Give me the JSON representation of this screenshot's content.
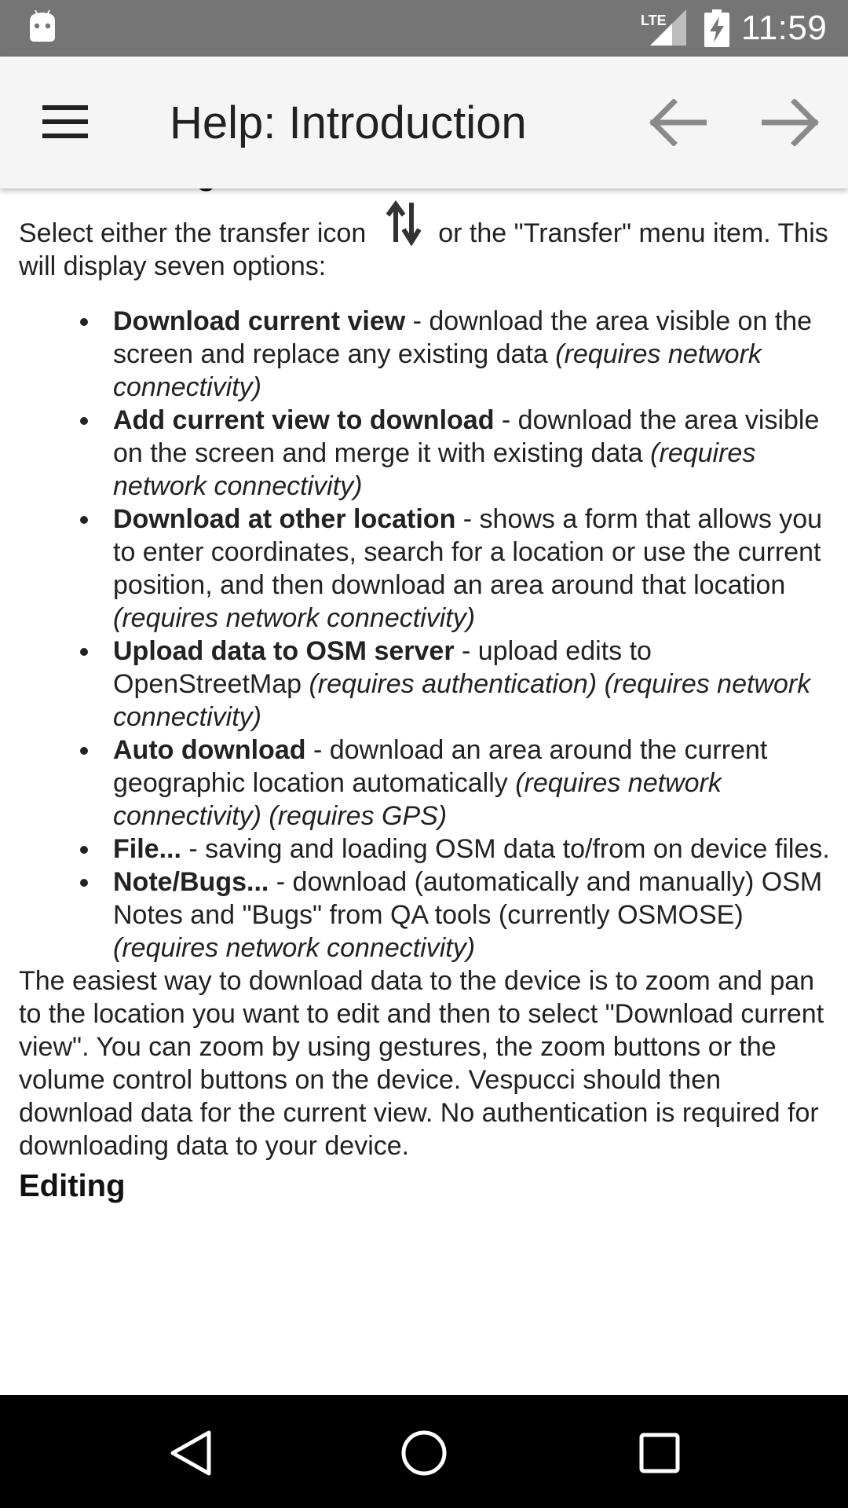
{
  "status_bar": {
    "network": "LTE",
    "time": "11:59"
  },
  "app_bar": {
    "title": "Help: Introduction"
  },
  "content": {
    "section_title": "Downloading OSM Data",
    "intro_before_icon": "Select either the transfer icon",
    "intro_after_icon": "or the \"Transfer\" menu item. This will display seven options:",
    "options": [
      {
        "name": "Download current view",
        "desc": " - download the area visible on the screen and replace any existing data ",
        "note": "(requires network connectivity)"
      },
      {
        "name": "Add current view to download",
        "desc": " - download the area visible on the screen and merge it with existing data ",
        "note": "(requires network connectivity)"
      },
      {
        "name": "Download at other location",
        "desc": " - shows a form that allows you to enter coordinates, search for a location or use the current position, and then download an area around that location ",
        "note": "(requires network connectivity)"
      },
      {
        "name": "Upload data to OSM server",
        "desc": " - upload edits to OpenStreetMap ",
        "note": "(requires authentication) (requires network connectivity)"
      },
      {
        "name": "Auto download",
        "desc": " - download an area around the current geographic location automatically ",
        "note": "(requires network connectivity) (requires GPS)"
      },
      {
        "name": "File...",
        "desc": " - saving and loading OSM data to/from on device files.",
        "note": ""
      },
      {
        "name": "Note/Bugs...",
        "desc": " - download (automatically and manually) OSM Notes and \"Bugs\" from QA tools (currently OSMOSE) ",
        "note": "(requires network connectivity)"
      }
    ],
    "paragraph": "The easiest way to download data to the device is to zoom and pan to the location you want to edit and then to select \"Download current view\". You can zoom by using gestures, the zoom buttons or the volume control buttons on the device. Vespucci should then download data for the current view. No authentication is required for downloading data to your device.",
    "next_section_title": "Editing"
  },
  "icons": {
    "android": "android-icon",
    "signal": "lte-signal-icon",
    "battery": "battery-charging-icon",
    "menu": "hamburger-menu-icon",
    "back": "arrow-back-icon",
    "forward": "arrow-forward-icon",
    "transfer": "transfer-icon",
    "nav_back": "nav-back-icon",
    "nav_home": "nav-home-icon",
    "nav_recent": "nav-recent-icon"
  },
  "colors": {
    "status_bar": "#757575",
    "app_bar": "#f5f5f5",
    "nav_bar": "#000000"
  }
}
